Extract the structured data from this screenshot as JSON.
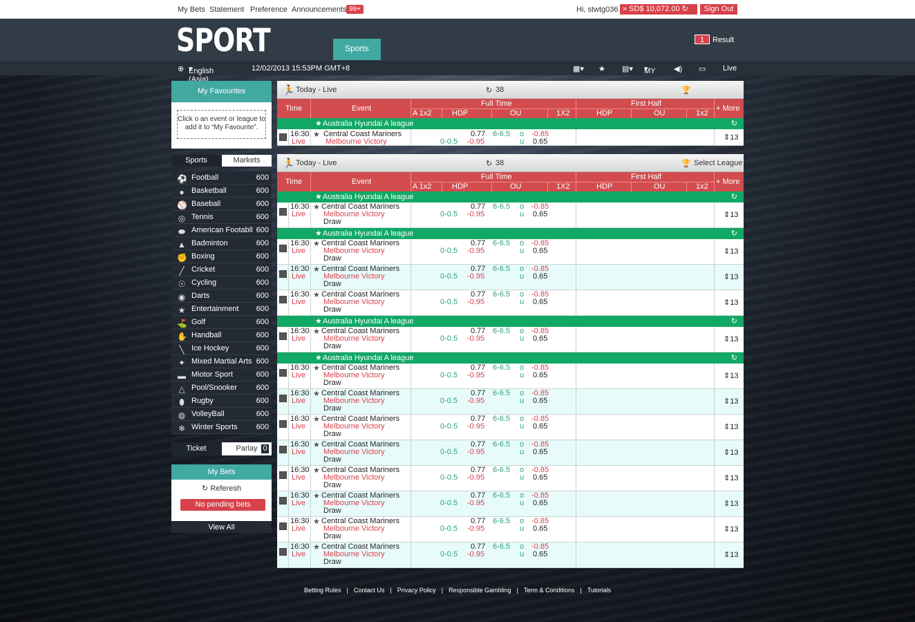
{
  "topbar": {
    "my_bets": "My Bets",
    "statement": "Statement",
    "preference": "Preference",
    "announcements": "Announcements",
    "badge": "99+",
    "greeting": "Hi, stwtg036",
    "balance": "SD$  10,072.00",
    "sign_out": "Sign Out"
  },
  "header": {
    "logo": "SPORT",
    "tab": "Sports",
    "result_count": "1",
    "result_label": "Result"
  },
  "subbar": {
    "language": "English (Asia)",
    "datetime": "12/02/2013  15:53PM GMT+8",
    "odds_type": "MY",
    "live": "Live"
  },
  "favourites": {
    "title": "My Favourites",
    "hint": "Click o an event or league to add it to “My Favourite”."
  },
  "side_tabs": {
    "sports": "Sports",
    "markets": "Markets"
  },
  "sports": [
    {
      "name": "Football",
      "count": "600",
      "icon": "football-icon",
      "g": "⚽"
    },
    {
      "name": "Basketball",
      "count": "600",
      "icon": "basketball-icon",
      "g": "●"
    },
    {
      "name": "Baseball",
      "count": "600",
      "icon": "baseball-icon",
      "g": "⚾"
    },
    {
      "name": "Tennis",
      "count": "600",
      "icon": "tennis-icon",
      "g": "◎"
    },
    {
      "name": "American Footabll",
      "count": "600",
      "icon": "american-football-icon",
      "g": "⬬"
    },
    {
      "name": "Badminton",
      "count": "600",
      "icon": "badminton-icon",
      "g": "▲"
    },
    {
      "name": "Boxing",
      "count": "600",
      "icon": "boxing-icon",
      "g": "✊"
    },
    {
      "name": "Cricket",
      "count": "600",
      "icon": "cricket-icon",
      "g": "╱"
    },
    {
      "name": "Cycling",
      "count": "600",
      "icon": "cycling-icon",
      "g": "☉"
    },
    {
      "name": "Darts",
      "count": "600",
      "icon": "darts-icon",
      "g": "◉"
    },
    {
      "name": "Entertainment",
      "count": "600",
      "icon": "entertainment-icon",
      "g": "★"
    },
    {
      "name": "Golf",
      "count": "600",
      "icon": "golf-icon",
      "g": "⛳"
    },
    {
      "name": "Handball",
      "count": "600",
      "icon": "handball-icon",
      "g": "✋"
    },
    {
      "name": "Ice Hockey",
      "count": "600",
      "icon": "ice-hockey-icon",
      "g": "╲"
    },
    {
      "name": "Mixed Martial Arts",
      "count": "600",
      "icon": "mma-icon",
      "g": "✦"
    },
    {
      "name": "Miotor Sport",
      "count": "600",
      "icon": "motor-sport-icon",
      "g": "▬"
    },
    {
      "name": "Pool/Snooker",
      "count": "600",
      "icon": "pool-icon",
      "g": "△"
    },
    {
      "name": "Rugby",
      "count": "600",
      "icon": "rugby-icon",
      "g": "⬮"
    },
    {
      "name": "VolleyBall",
      "count": "600",
      "icon": "volleyball-icon",
      "g": "◍"
    },
    {
      "name": "Winter Sports",
      "count": "600",
      "icon": "winter-sports-icon",
      "g": "❄"
    }
  ],
  "ticket": {
    "ticket": "Ticket",
    "parlay": "Parlay",
    "count": "0"
  },
  "mybets": {
    "title": "My Bets",
    "refresh": "Referesh",
    "no_pending": "No pending bets",
    "view_all": "View All"
  },
  "panel1": {
    "title": "Today - Live",
    "count": "38",
    "right": ""
  },
  "panel2": {
    "title": "Today - Live",
    "count": "38",
    "right": "Select League"
  },
  "columns": {
    "time": "Time",
    "event": "Event",
    "full_time": "Full Time",
    "first_half": "First Half",
    "a1x2": "A 1x2",
    "hdp": "HDP",
    "ou": "OU",
    "x12": "1X2",
    "x12b": "1x2",
    "more": "+ More"
  },
  "league": "Australia Hyundai A league",
  "match": {
    "time": "16:30",
    "live": "Live",
    "home": "Central Coast Mariners",
    "away": "Melbourne Victory",
    "draw": "Draw",
    "hdp_line": "0-0.5",
    "hdp_home": "0.77",
    "hdp_away": "-0.95",
    "ou_line": "6-6.5",
    "over": "o",
    "under": "u",
    "ou_over": "-0.85",
    "ou_under": "0.65",
    "more": "13"
  },
  "footer": [
    "Betting Rules",
    "Contact Us",
    "Privacy Policy",
    "Responsible Gambling",
    "Term & Conditions",
    "Tutorials"
  ]
}
